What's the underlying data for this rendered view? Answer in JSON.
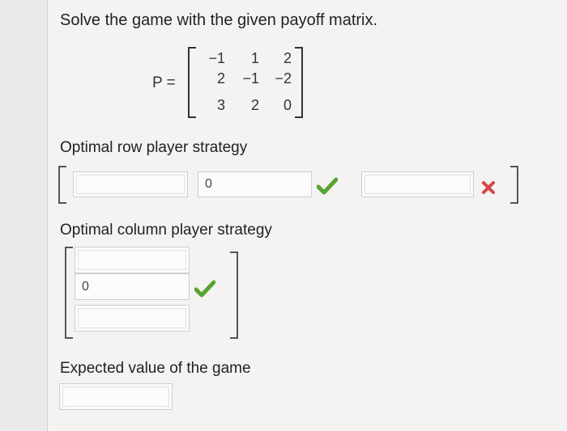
{
  "question": {
    "text": "Solve the game with the given payoff matrix."
  },
  "matrix": {
    "label": "P =",
    "rows": [
      [
        "−1",
        "1",
        "2"
      ],
      [
        "2",
        "−1",
        "−2"
      ],
      [
        "3",
        "2",
        "0"
      ]
    ]
  },
  "row_strategy": {
    "label": "Optimal row player strategy",
    "inputs": [
      {
        "value": "",
        "status": "none"
      },
      {
        "value": "0",
        "status": "correct"
      },
      {
        "value": "",
        "status": "incorrect"
      }
    ]
  },
  "column_strategy": {
    "label": "Optimal column player strategy",
    "inputs": [
      {
        "value": "",
        "status": "none"
      },
      {
        "value": "0",
        "status": "correct"
      },
      {
        "value": "",
        "status": "none"
      }
    ]
  },
  "expected_value": {
    "label": "Expected value of the game",
    "value": ""
  },
  "colors": {
    "correct": "#5aa332",
    "incorrect": "#d64545"
  },
  "icons": {
    "correct": "check-icon",
    "incorrect": "x-icon"
  }
}
